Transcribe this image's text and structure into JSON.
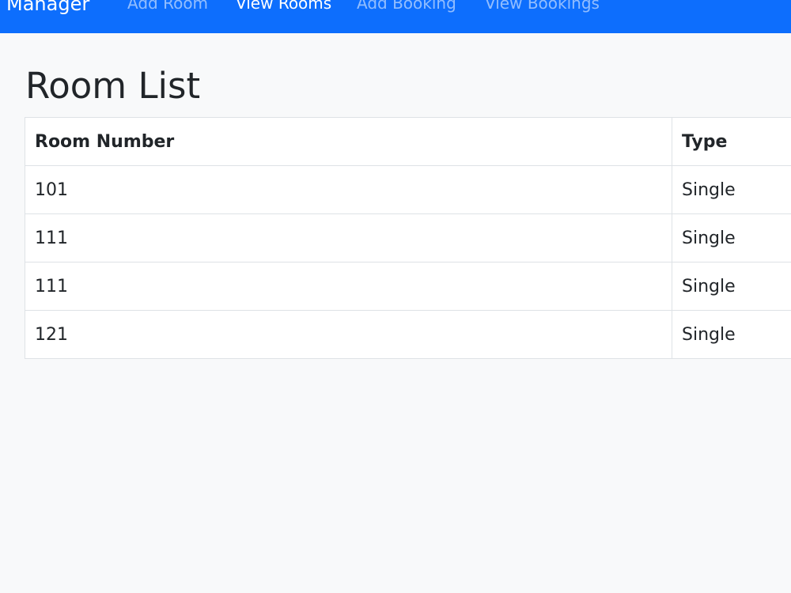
{
  "navbar": {
    "brand": "Manager",
    "links": [
      {
        "label": "Add Room",
        "active": false
      },
      {
        "label": "View Rooms",
        "active": true
      },
      {
        "label": "Add Booking",
        "active": false
      },
      {
        "label": "View Bookings",
        "active": false
      }
    ],
    "color": "#0d6efd"
  },
  "main": {
    "title": "Room List",
    "table": {
      "headers": [
        "Room Number",
        "Type"
      ],
      "rows": [
        [
          "101",
          "Single"
        ],
        [
          "111",
          "Single"
        ],
        [
          "111",
          "Single"
        ],
        [
          "121",
          "Single"
        ]
      ]
    }
  }
}
